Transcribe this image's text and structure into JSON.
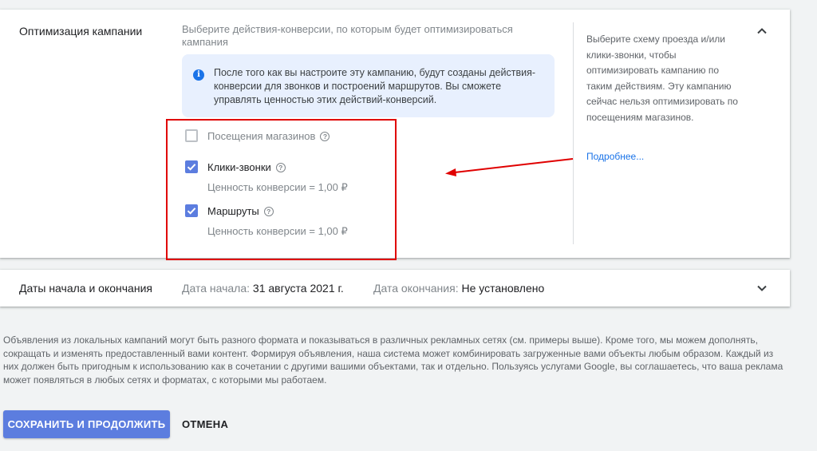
{
  "optimization": {
    "title": "Оптимизация кампании",
    "subtitle": "Выберите действия-конверсии, по которым будет оптимизироваться кампания",
    "info": "После того как вы настроите эту кампанию, будут созданы действия-конверсии для звонков и построений маршрутов. Вы сможете управлять ценностью этих действий-конверсий.",
    "options": [
      {
        "label": "Посещения магазинов",
        "checked": false,
        "value": ""
      },
      {
        "label": "Клики-звонки",
        "checked": true,
        "value": "Ценность конверсии = 1,00 ₽"
      },
      {
        "label": "Маршруты",
        "checked": true,
        "value": "Ценность конверсии = 1,00 ₽"
      }
    ],
    "side_text": "Выберите схему проезда и/или клики-звонки, чтобы оптимизировать кампанию по таким действиям. Эту кампанию сейчас нельзя оптимизировать по посещениям магазинов.",
    "side_link": "Подробнее...",
    "chevron": "chevron-up-icon"
  },
  "dates": {
    "title": "Даты начала и окончания",
    "start_label": "Дата начала:",
    "start_value": "31 августа 2021 г.",
    "end_label": "Дата окончания:",
    "end_value": "Не установлено",
    "chevron": "chevron-down-icon"
  },
  "disclaimer": "Объявления из локальных кампаний могут быть разного формата и показываться в различных рекламных сетях (см. примеры выше). Кроме того, мы можем дополнять, сокращать и изменять предоставленный вами контент. Формируя объявления, наша система может комбинировать загруженные вами объекты любым образом. Каждый из них должен быть пригодным к использованию как в сочетании с другими вашими объектами, так и отдельно. Пользуясь услугами Google, вы соглашаетесь, что ваша реклама может появляться в любых сетях и форматах, с которыми мы работаем.",
  "actions": {
    "save": "СОХРАНИТЬ И ПРОДОЛЖИТЬ",
    "cancel": "ОТМЕНА"
  },
  "colors": {
    "accent": "#5c7ddf",
    "link": "#1a73e8",
    "annotation": "#e00000",
    "info_bg": "#e8f0fe"
  }
}
